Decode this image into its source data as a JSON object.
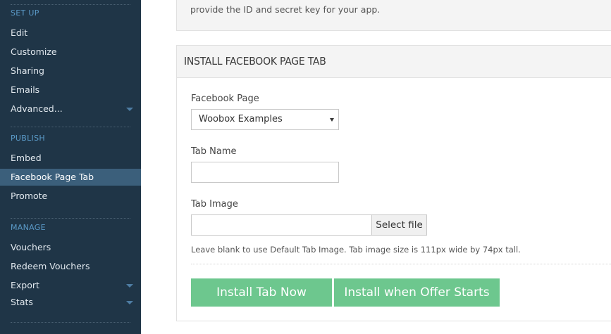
{
  "sidebar": {
    "sections": [
      {
        "heading": "SET UP",
        "items": [
          {
            "label": "Edit"
          },
          {
            "label": "Customize"
          },
          {
            "label": "Sharing"
          },
          {
            "label": "Emails"
          },
          {
            "label": "Advanced..."
          }
        ]
      },
      {
        "heading": "PUBLISH",
        "items": [
          {
            "label": "Embed"
          },
          {
            "label": "Facebook Page Tab"
          },
          {
            "label": "Promote"
          }
        ]
      },
      {
        "heading": "MANAGE",
        "items": [
          {
            "label": "Vouchers"
          },
          {
            "label": "Redeem Vouchers"
          },
          {
            "label": "Export"
          },
          {
            "label": "Stats"
          }
        ]
      }
    ],
    "active_item": "Facebook Page Tab"
  },
  "top_panel": {
    "text": "provide the ID and secret key for your app."
  },
  "install_panel": {
    "title": "INSTALL FACEBOOK PAGE TAB",
    "facebook_page": {
      "label": "Facebook Page",
      "selected": "Woobox Examples"
    },
    "tab_name": {
      "label": "Tab Name",
      "value": ""
    },
    "tab_image": {
      "label": "Tab Image",
      "select_file_label": "Select file",
      "hint": "Leave blank to use Default Tab Image. Tab image size is 111px wide by 74px tall."
    },
    "install_now_label": "Install Tab Now",
    "install_when_starts_label": "Install when Offer Starts"
  },
  "colors": {
    "sidebar_bg": "#1f3547",
    "sidebar_active": "#3b5f7b",
    "section_heading": "#5b9bc9",
    "button_green": "#6dc78e"
  }
}
